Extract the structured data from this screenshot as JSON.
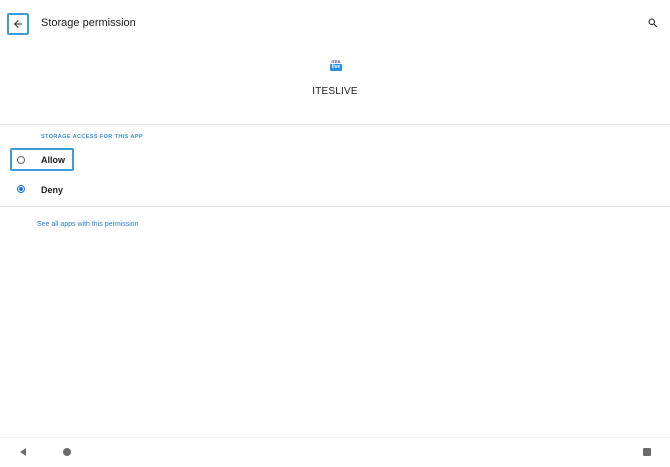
{
  "header": {
    "title": "Storage permission",
    "back_icon": "arrow-back-icon",
    "search_icon": "search-icon"
  },
  "app": {
    "logo_top": "ITES",
    "logo_bottom": "live",
    "name": "ITESLIVE"
  },
  "section": {
    "label": "STORAGE ACCESS FOR THIS APP"
  },
  "options": [
    {
      "label": "Allow",
      "selected": false
    },
    {
      "label": "Deny",
      "selected": true
    }
  ],
  "links": {
    "see_all": "See all apps with this permission"
  },
  "colors": {
    "accent": "#1a73e8",
    "highlight": "#3d9bd6",
    "link": "#2b7fd6"
  }
}
